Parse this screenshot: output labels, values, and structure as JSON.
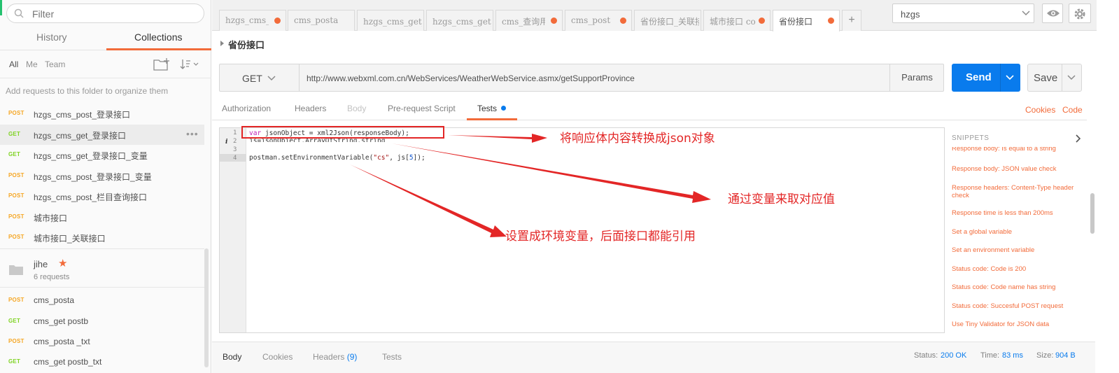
{
  "sidebar": {
    "filter_placeholder": "Filter",
    "tabs": {
      "history": "History",
      "collections": "Collections"
    },
    "scopes": {
      "all": "All",
      "me": "Me",
      "team": "Team"
    },
    "hint": "Add requests to this folder to organize them",
    "requests": [
      {
        "method": "POST",
        "name": "hzgs_cms_post_登录接口"
      },
      {
        "method": "GET",
        "name": "hzgs_cms_get_登录接口",
        "more": "•••"
      },
      {
        "method": "GET",
        "name": "hzgs_cms_get_登录接口_变量"
      },
      {
        "method": "POST",
        "name": "hzgs_cms_post_登录接口_变量"
      },
      {
        "method": "POST",
        "name": "hzgs_cms_post_栏目查询接口"
      },
      {
        "method": "POST",
        "name": "城市接口"
      },
      {
        "method": "POST",
        "name": "城市接口_关联接口"
      }
    ],
    "folder": {
      "name": "jihe",
      "star": "★",
      "count": "6 requests"
    },
    "folder_requests": [
      {
        "method": "POST",
        "name": "cms_posta"
      },
      {
        "method": "GET",
        "name": "cms_get postb"
      },
      {
        "method": "POST",
        "name": "cms_posta _txt"
      },
      {
        "method": "GET",
        "name": "cms_get postb_txt"
      }
    ]
  },
  "tabs": [
    {
      "label": "hzgs_cms_p",
      "dot": true
    },
    {
      "label": "cms_posta",
      "dot": false
    },
    {
      "label": "hzgs_cms_get_登",
      "dot": false
    },
    {
      "label": "hzgs_cms_get_登",
      "dot": false
    },
    {
      "label": "cms_查询用",
      "dot": true
    },
    {
      "label": "cms_post",
      "dot": true
    },
    {
      "label": "省份接口_关联接口",
      "dot": false
    },
    {
      "label": "城市接口 co",
      "dot": true
    },
    {
      "label": "省份接口",
      "dot": true
    }
  ],
  "add_tab": "+",
  "env": {
    "selected": "hzgs"
  },
  "request": {
    "title": "省份接口",
    "method": "GET",
    "url": "http://www.webxml.com.cn/WebServices/WeatherWebService.asmx/getSupportProvince",
    "params_label": "Params",
    "send_label": "Send",
    "save_label": "Save"
  },
  "sub_tabs": {
    "authorization": "Authorization",
    "headers": "Headers",
    "body": "Body",
    "prerequest": "Pre-request Script",
    "tests": "Tests",
    "cookies": "Cookies",
    "code": "Code"
  },
  "editor": {
    "line_numbers": [
      "1",
      "2",
      "3",
      "4"
    ],
    "info_mark": "i",
    "line1": {
      "kw": "var",
      "rest": " jsonObject = xml2Json(responseBody);"
    },
    "line2": "js=jsonObject.ArrayOfString.string",
    "line4": {
      "a": "postman.setEnvironmentVariable(",
      "s": "\"cs\"",
      "b": ", js[",
      "n": "5",
      "c": "]);"
    }
  },
  "snippets": {
    "title": "SNIPPETS",
    "items": [
      "Response body: Is equal to a string",
      "Response body: JSON value check",
      "Response headers: Content-Type header check",
      "Response time is less than 200ms",
      "Set a global variable",
      "Set an environment variable",
      "Status code: Code is 200",
      "Status code: Code name has string",
      "Status code: Succesful POST request",
      "Use Tiny Validator for JSON data"
    ]
  },
  "annotations": {
    "a1": "将响应体内容转换成json对象",
    "a2": "通过变量来取对应值",
    "a3": "设置成环境变量，后面接口都能引用"
  },
  "response": {
    "tabs": {
      "body": "Body",
      "cookies": "Cookies",
      "headers": "Headers",
      "headers_count": "(9)",
      "tests": "Tests"
    },
    "status_label": "Status:",
    "status_value": "200 OK",
    "time_label": "Time:",
    "time_value": "83 ms",
    "size_label": "Size:",
    "size_value": "904 B"
  },
  "colors": {
    "accent": "#f26b3a",
    "send": "#097bed",
    "post": "#f5a623",
    "get": "#7ed321",
    "annotation": "#e32626"
  }
}
